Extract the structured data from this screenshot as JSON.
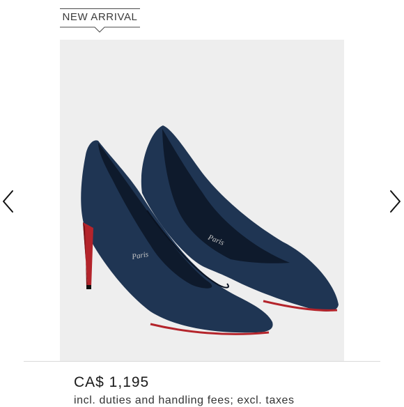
{
  "badge": {
    "label": "NEW ARRIVAL"
  },
  "product": {
    "image_alt": "Navy suede pointed-toe pumps with red soles",
    "insole_brand_text": "Paris",
    "price": "CA$ 1,195",
    "fees_note": "incl. duties and handling fees; excl. taxes"
  },
  "navigation": {
    "previous_icon": "chevron-left-icon",
    "next_icon": "chevron-right-icon"
  },
  "colors": {
    "suede": "#1f3553",
    "sole": "#b4242b",
    "image_background": "#eeeeee"
  }
}
